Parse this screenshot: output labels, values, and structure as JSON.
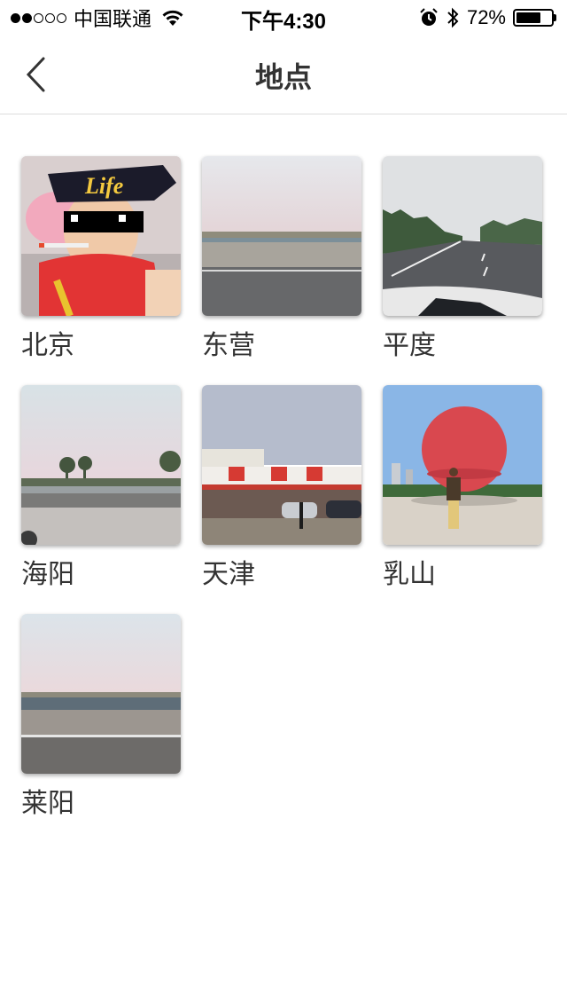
{
  "status_bar": {
    "carrier": "中国联通",
    "time": "下午4:30",
    "battery_percent": "72%",
    "battery_level": 0.72,
    "signal_bars_filled": 2,
    "signal_bars_total": 5
  },
  "navbar": {
    "title": "地点",
    "back_icon": "chevron-left-icon"
  },
  "places": [
    {
      "name": "北京",
      "photo": "child-with-sunglasses"
    },
    {
      "name": "东营",
      "photo": "highway-roadside"
    },
    {
      "name": "平度",
      "photo": "highway-car-hood"
    },
    {
      "name": "海阳",
      "photo": "roadside-trees"
    },
    {
      "name": "天津",
      "photo": "service-area-building"
    },
    {
      "name": "乳山",
      "photo": "red-sphere-monument"
    },
    {
      "name": "莱阳",
      "photo": "flat-road-horizon"
    }
  ],
  "colors": {
    "background": "#ffffff",
    "divider": "#dcdcdc",
    "text": "#333333"
  }
}
